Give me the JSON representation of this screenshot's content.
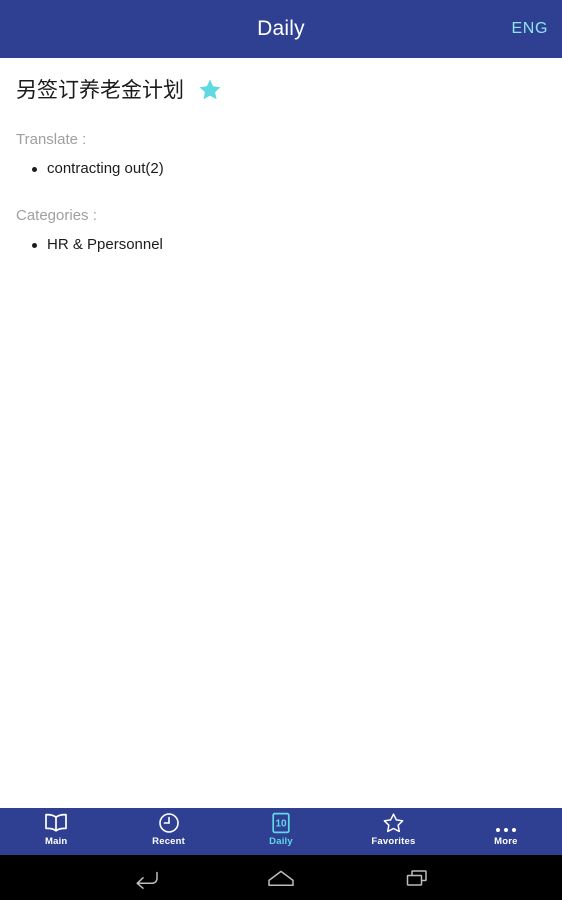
{
  "header": {
    "title": "Daily",
    "language_button": "ENG",
    "bar_color": "#2f4093",
    "title_color": "#ffffff",
    "language_color": "#8fe3f2"
  },
  "entry": {
    "title": "另签订养老金计划",
    "favorite_star_icon": "star-filled-icon",
    "favorite_star_color": "#5fd8e0",
    "sections": [
      {
        "label": "Translate :",
        "items": [
          "contracting out(2)"
        ]
      },
      {
        "label": "Categories :",
        "items": [
          "HR & Ppersonnel"
        ]
      }
    ]
  },
  "tabbar": {
    "active_color": "#5fd8e8",
    "inactive_color": "#ffffff",
    "background": "#2f4093",
    "tabs": [
      {
        "label": "Main",
        "icon": "open-book-icon",
        "active": false
      },
      {
        "label": "Recent",
        "icon": "clock-icon",
        "active": false
      },
      {
        "label": "Daily",
        "icon": "calendar-10-icon",
        "active": true
      },
      {
        "label": "Favorites",
        "icon": "star-outline-icon",
        "active": false
      },
      {
        "label": "More",
        "icon": "more-dots-icon",
        "active": false
      }
    ]
  },
  "system_nav": {
    "background": "#000000",
    "buttons": [
      {
        "name": "back-icon"
      },
      {
        "name": "home-icon"
      },
      {
        "name": "recents-icon"
      }
    ]
  }
}
